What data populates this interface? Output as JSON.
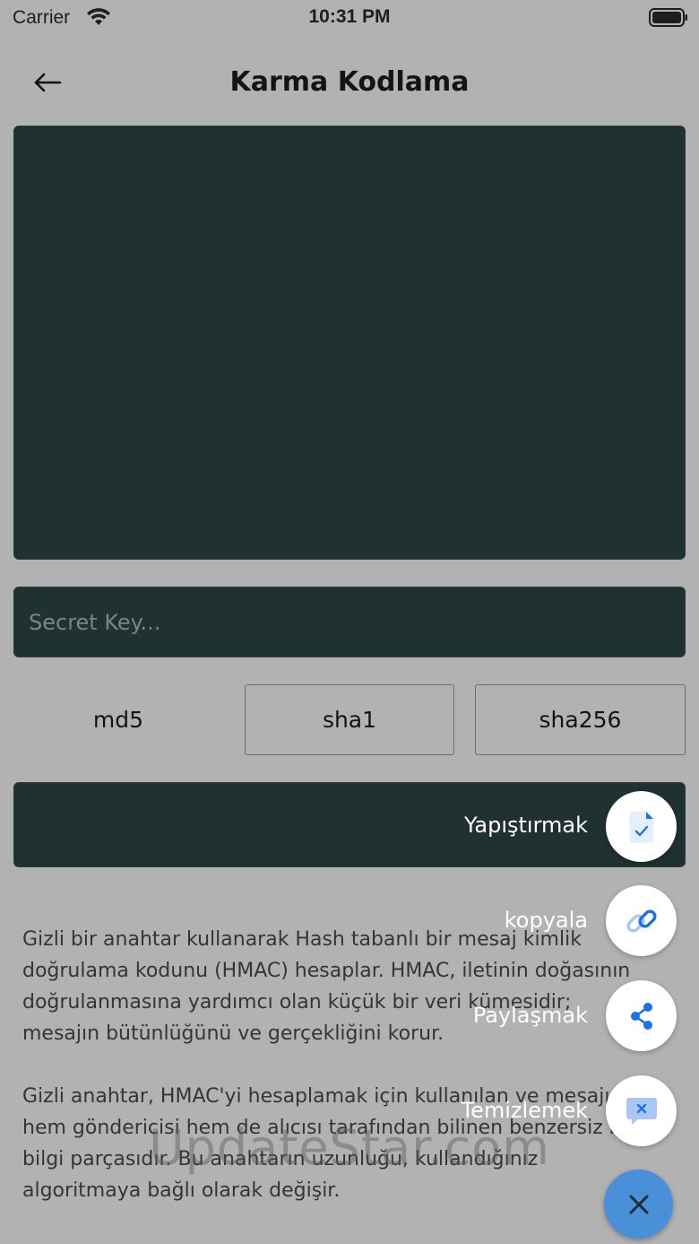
{
  "status_bar": {
    "carrier": "Carrier",
    "time": "10:31 PM"
  },
  "header": {
    "title": "Karma Kodlama",
    "back_icon": "arrow-left-icon"
  },
  "secret_key": {
    "placeholder": "Secret Key..."
  },
  "algorithms": [
    "md5",
    "sha1",
    "sha256"
  ],
  "description": {
    "paragraph1": "Gizli bir anahtar kullanarak Hash tabanlı bir mesaj kimlik doğrulama kodunu (HMAC) hesaplar. HMAC, iletinin doğasının doğrulanmasına yardımcı olan küçük bir veri kümesidir; mesajın bütünlüğünü ve gerçekliğini korur.",
    "paragraph2": "Gizli anahtar, HMAC'yi hesaplamak için kullanılan ve mesajın hem göndericisi hem de alıcısı tarafından bilinen benzersiz bir bilgi parçasıdır. Bu anahtarın uzunluğu, kullandığınız algoritmaya bağlı olarak değişir."
  },
  "watermark": "UpdateStar.com",
  "fab_menu": {
    "paste": {
      "label": "Yapıştırmak",
      "icon": "paste-icon"
    },
    "copy": {
      "label": "kopyala",
      "icon": "link-icon"
    },
    "share": {
      "label": "Paylaşmak",
      "icon": "share-icon"
    },
    "clear": {
      "label": "Temizlemek",
      "icon": "clear-chat-icon"
    },
    "close_icon": "close-icon"
  },
  "colors": {
    "background": "#b2b2b2",
    "panel": "#1f3130",
    "accent": "#4a90d9",
    "icon_blue": "#1a73e8"
  }
}
